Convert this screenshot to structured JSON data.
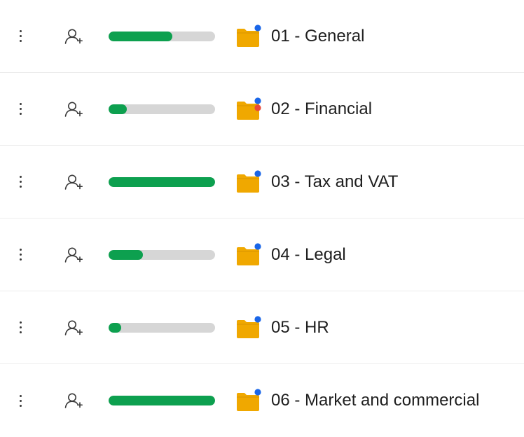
{
  "colors": {
    "progress_fill": "#0da04f",
    "progress_track": "#d6d6d6",
    "folder": "#f0a800",
    "badge_blue": "#1a66e8",
    "badge_red": "#e8493a"
  },
  "icons": {
    "menu": "more-vertical-icon",
    "add_user": "user-plus-icon",
    "folder": "folder-icon"
  },
  "folders": [
    {
      "name": "01 - General",
      "progress": 0.6,
      "badges": [
        "blue"
      ]
    },
    {
      "name": "02 - Financial",
      "progress": 0.17,
      "badges": [
        "blue",
        "red"
      ]
    },
    {
      "name": "03 - Tax and VAT",
      "progress": 1.0,
      "badges": [
        "blue"
      ]
    },
    {
      "name": "04 - Legal",
      "progress": 0.32,
      "badges": [
        "blue"
      ]
    },
    {
      "name": "05 - HR",
      "progress": 0.12,
      "badges": [
        "blue"
      ]
    },
    {
      "name": "06 - Market and commercial",
      "progress": 1.0,
      "badges": [
        "blue"
      ]
    }
  ]
}
